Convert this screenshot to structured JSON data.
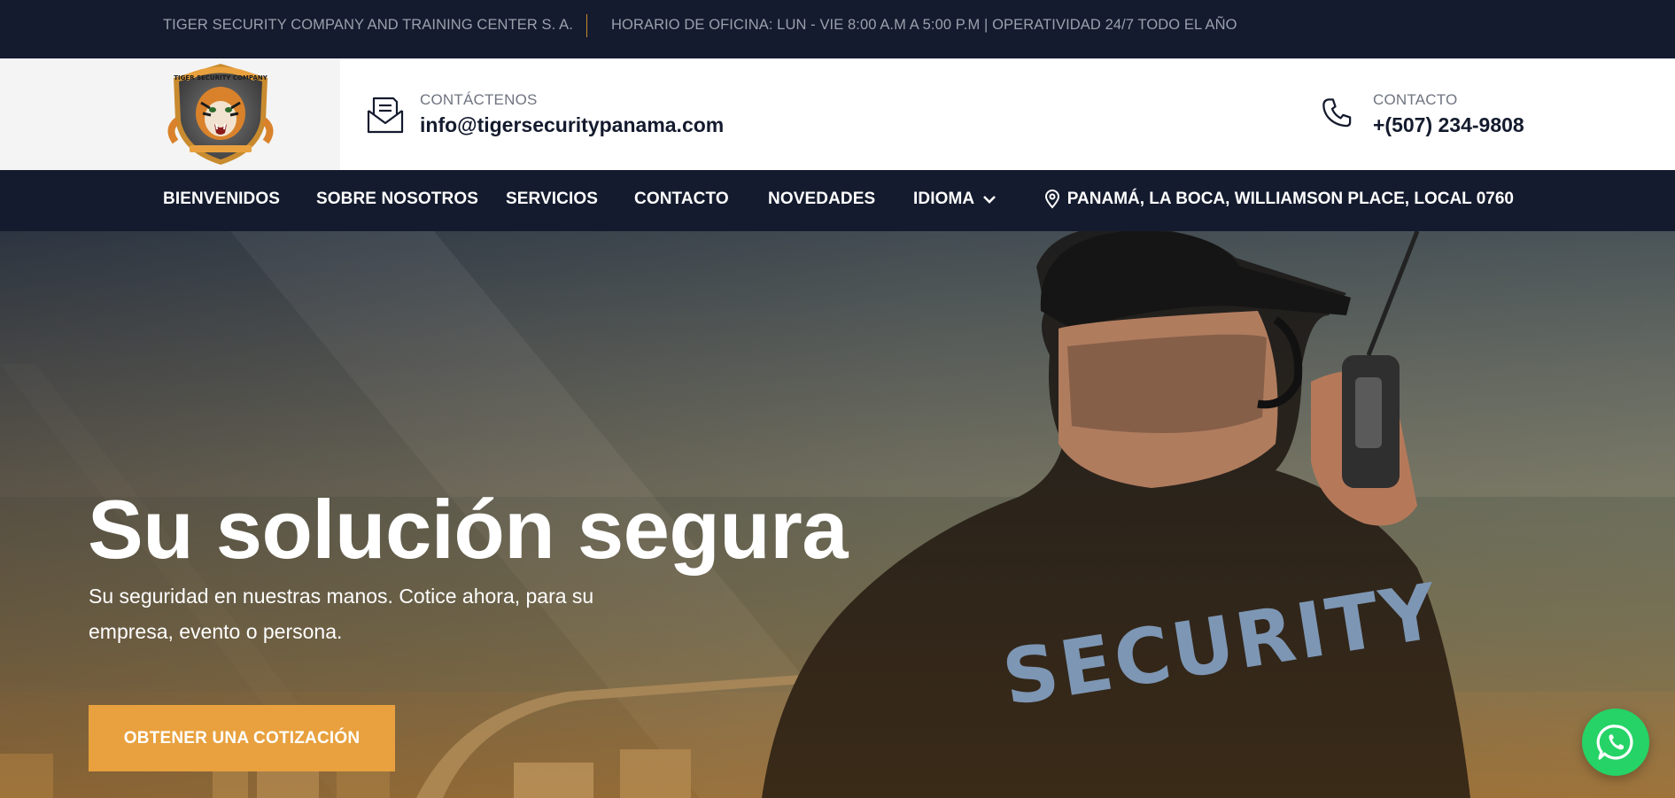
{
  "topbar": {
    "company": "TIGER SECURITY COMPANY AND TRAINING CENTER S. A.",
    "hours": "HORARIO DE OFICINA: LUN - VIE 8:00 A.M A 5:00 P.M | OPERATIVIDAD 24/7 TODO EL AÑO"
  },
  "header": {
    "logo_text": "TIGER SECURITY COMPANY",
    "email_label": "CONTÁCTENOS",
    "email_value": "info@tigersecuritypanama.com",
    "phone_label": "CONTACTO",
    "phone_value": "+(507) 234-9808"
  },
  "nav": {
    "items": [
      {
        "label": "BIENVENIDOS"
      },
      {
        "label": "SOBRE NOSOTROS"
      },
      {
        "label": "SERVICIOS"
      },
      {
        "label": "CONTACTO"
      },
      {
        "label": "NOVEDADES"
      },
      {
        "label": "IDIOMA"
      }
    ],
    "address": "PANAMÁ, LA BOCA, WILLIAMSON PLACE, LOCAL 0760"
  },
  "hero": {
    "title": "Su solución segura",
    "subtitle": "Su seguridad en nuestras manos. Cotice ahora, para su empresa, evento o persona.",
    "cta_label": "OBTENER UNA COTIZACIÓN",
    "shirt_text": "SECURITY"
  },
  "icons": {
    "email": "envelope-icon",
    "phone": "phone-icon",
    "pin": "map-pin-icon",
    "chevron": "chevron-down-icon",
    "whatsapp": "whatsapp-icon"
  },
  "colors": {
    "dark_navy": "#141b2e",
    "accent_orange": "#e8a13e",
    "whatsapp_green": "#25d366"
  }
}
